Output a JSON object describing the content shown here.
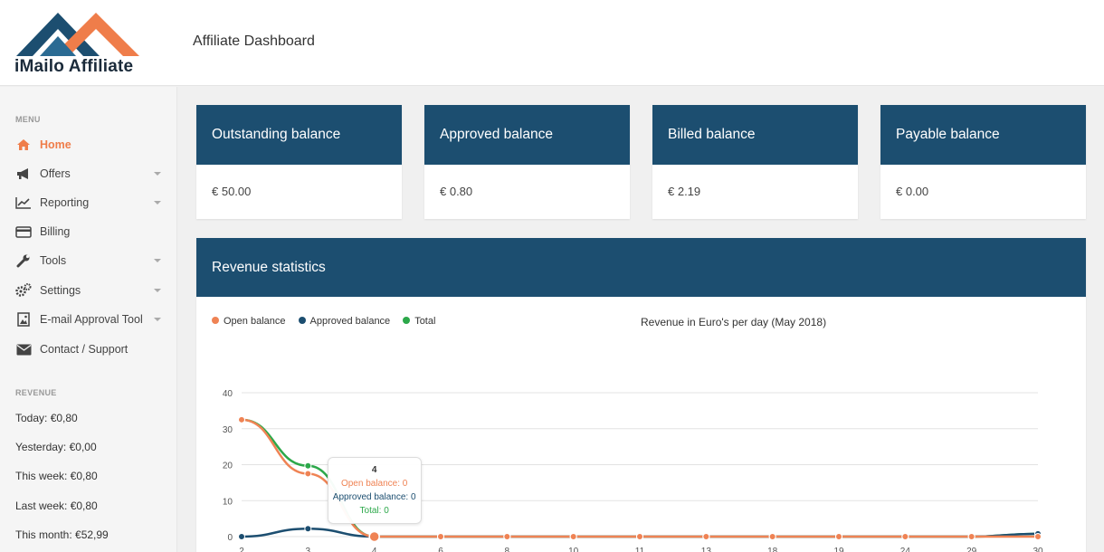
{
  "header": {
    "logo_text": "iMailo Affiliate",
    "title": "Affiliate Dashboard"
  },
  "sidebar": {
    "menu_label": "MENU",
    "items": [
      {
        "label": "Home",
        "icon": "home-icon",
        "active": true,
        "has_caret": false
      },
      {
        "label": "Offers",
        "icon": "megaphone-icon",
        "active": false,
        "has_caret": true
      },
      {
        "label": "Reporting",
        "icon": "line-chart-icon",
        "active": false,
        "has_caret": true
      },
      {
        "label": "Billing",
        "icon": "credit-card-icon",
        "active": false,
        "has_caret": false
      },
      {
        "label": "Tools",
        "icon": "wrench-icon",
        "active": false,
        "has_caret": true
      },
      {
        "label": "Settings",
        "icon": "gears-icon",
        "active": false,
        "has_caret": true
      },
      {
        "label": "E-mail Approval Tool",
        "icon": "image-icon",
        "active": false,
        "has_caret": true
      },
      {
        "label": "Contact / Support",
        "icon": "envelope-icon",
        "active": false,
        "has_caret": false
      }
    ],
    "revenue_label": "REVENUE",
    "revenue": [
      "Today: €0,80",
      "Yesterday: €0,00",
      "This week: €0,80",
      "Last week: €0,80",
      "This month: €52,99"
    ]
  },
  "cards": [
    {
      "title": "Outstanding balance",
      "value": "€ 50.00"
    },
    {
      "title": "Approved balance",
      "value": "€ 0.80"
    },
    {
      "title": "Billed balance",
      "value": "€ 2.19"
    },
    {
      "title": "Payable balance",
      "value": "€ 0.00"
    }
  ],
  "revenue_panel": {
    "title": "Revenue statistics"
  },
  "colors": {
    "brand_blue": "#1c4e70",
    "open_balance": "#ef8354",
    "approved_balance": "#1c4e70",
    "total": "#2ca84a",
    "active_nav": "#ef7d4a"
  },
  "chart_data": {
    "type": "line",
    "title": "Revenue in Euro's per day (May 2018)",
    "x": [
      "2",
      "3",
      "4",
      "6",
      "8",
      "10",
      "11",
      "13",
      "18",
      "19",
      "24",
      "29",
      "30"
    ],
    "ylim": [
      0,
      40
    ],
    "yticks": [
      0,
      10,
      20,
      30,
      40
    ],
    "grid": true,
    "legend_position": "top-left",
    "series": [
      {
        "name": "Open balance",
        "values": [
          32.5,
          17.5,
          0,
          0,
          0,
          0,
          0,
          0,
          0,
          0,
          0,
          0,
          0
        ]
      },
      {
        "name": "Approved balance",
        "values": [
          0,
          2.2,
          0,
          0,
          0,
          0,
          0,
          0,
          0,
          0,
          0,
          0,
          0.8
        ]
      },
      {
        "name": "Total",
        "values": [
          32.5,
          19.7,
          0,
          0,
          0,
          0,
          0,
          0,
          0,
          0,
          0,
          0,
          0.8
        ]
      }
    ],
    "tooltip": {
      "title": "4",
      "lines": [
        "Open balance: 0",
        "Approved balance: 0",
        "Total: 0"
      ]
    }
  }
}
